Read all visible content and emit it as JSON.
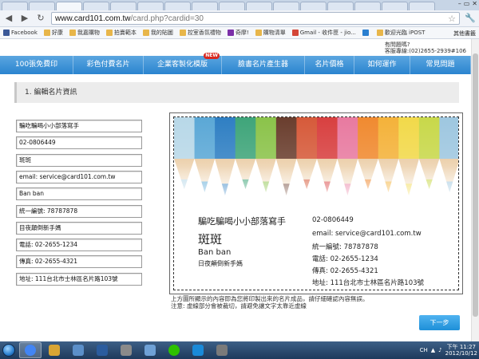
{
  "browser": {
    "tabs": [
      "",
      "",
      "",
      "",
      "",
      "",
      "",
      "",
      "",
      "",
      "",
      "",
      "",
      "",
      "",
      ""
    ],
    "url_host": "www.card101.com.tw",
    "url_path": "/card.php?cardid=30",
    "bookmarks": [
      {
        "label": "Facebook",
        "color": "#3b5998"
      },
      {
        "label": "好康",
        "color": "#e8b64a"
      },
      {
        "label": "我嘉購物",
        "color": "#e8b64a"
      },
      {
        "label": "拍賣範本",
        "color": "#e8b64a"
      },
      {
        "label": "我的貼圖",
        "color": "#e8b64a"
      },
      {
        "label": "控室香氛禮物",
        "color": "#e8b64a"
      },
      {
        "label": "奇摩!",
        "color": "#7b2fa8"
      },
      {
        "label": "購物清單",
        "color": "#e8b64a"
      },
      {
        "label": "Gmail - 收件匣 - jio...",
        "color": "#d44638"
      },
      {
        "label": "",
        "color": "#2a7fd0"
      },
      {
        "label": "歡迎光臨 iPOST",
        "color": "#e8b64a"
      }
    ],
    "bookmarks_other": "其他書籤"
  },
  "page": {
    "help_line1": "有問題嗎?",
    "help_line2": "客服專線:(02)2655-2939#106",
    "nav": [
      {
        "label": "100張免費印",
        "new": false
      },
      {
        "label": "彩色付費名片",
        "new": false
      },
      {
        "label": "企業客製化模版",
        "new": true
      },
      {
        "label": "臉書名片產生器",
        "new": false
      },
      {
        "label": "名片價格",
        "new": false
      },
      {
        "label": "如何運作",
        "new": false
      },
      {
        "label": "常見問題",
        "new": false
      }
    ],
    "new_badge": "NEW",
    "section_title": "1. 編輯名片資訊",
    "fields": [
      "騙吃騙喝小小部落寫手",
      "02-0806449",
      "斑斑",
      "email: service@card101.com.tw",
      "Ban ban",
      "統一編號: 78787878",
      "目夜顛倒新手媽",
      "電話: 02-2655-1234",
      "傳真: 02-2655-4321",
      "地址: 111台北市士林區名片路103號"
    ],
    "card": {
      "tagline": "騙吃騙喝小小部落寫手",
      "name": "斑斑",
      "name_en": "Ban ban",
      "title": "日夜顛倒新手媽",
      "phone_top": "02-0806449",
      "email": "email: service@card101.com.tw",
      "tax_id": "統一編號: 78787878",
      "tel": "電話: 02-2655-1234",
      "fax": "傳真: 02-2655-4321",
      "address": "地址: 111台北市士林區名片路103號"
    },
    "note_line1": "上方圖所顯示的內容即為您將印製出來的名片成品，請仔細確認內容無誤。",
    "note_line2": "注意: 虛線部分會被裁切，請避免讓文字太靠近虛線",
    "next_button": "下一步"
  },
  "taskbar": {
    "apps": [
      {
        "name": "chrome",
        "color": "#4285f4",
        "active": true
      },
      {
        "name": "explorer",
        "color": "#d9a534",
        "active": false
      },
      {
        "name": "app3",
        "color": "#5b8fc9",
        "active": false
      },
      {
        "name": "app4",
        "color": "#2b5c9e",
        "active": false
      },
      {
        "name": "app5",
        "color": "#8a8a8a",
        "active": false
      },
      {
        "name": "app6",
        "color": "#6fa1d6",
        "active": false
      },
      {
        "name": "line",
        "color": "#2dc100",
        "active": false
      },
      {
        "name": "ie",
        "color": "#1a8ad9",
        "active": false
      },
      {
        "name": "app9",
        "color": "#7a7a7a",
        "active": false
      }
    ],
    "lang": "CH",
    "time": "下午 11:27",
    "date": "2012/10/12"
  }
}
